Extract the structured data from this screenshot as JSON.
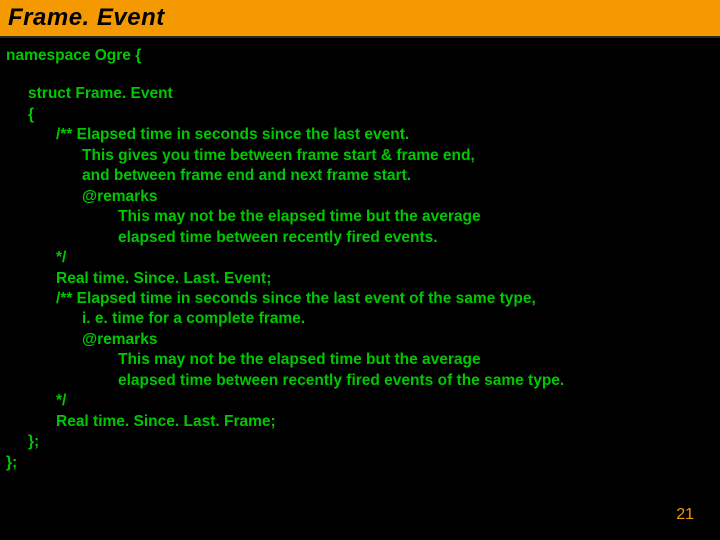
{
  "title": "Frame. Event",
  "code": {
    "ns_open": "namespace Ogre {",
    "struct_decl": "struct Frame. Event",
    "brace_open": "{",
    "c1_l1": "/** Elapsed time in seconds since the last event.",
    "c1_l2": "This gives you time between frame start & frame end,",
    "c1_l3": "and between frame end and next frame start.",
    "c1_l4": "@remarks",
    "c1_l5": "This may not be the elapsed time but the average",
    "c1_l6": "elapsed time between recently fired events.",
    "c1_close": "*/",
    "field1": "Real time. Since. Last. Event;",
    "c2_l1": "/** Elapsed time in seconds since the last event of the same type,",
    "c2_l2": "i. e. time for a complete frame.",
    "c2_l3": "@remarks",
    "c2_l4": "This may not be the elapsed time but the average",
    "c2_l5": "elapsed time between recently fired events of the same type.",
    "c2_close": "*/",
    "field2": "Real time. Since. Last. Frame;",
    "brace_close": "};",
    "ns_close": "};"
  },
  "page_number": "21"
}
